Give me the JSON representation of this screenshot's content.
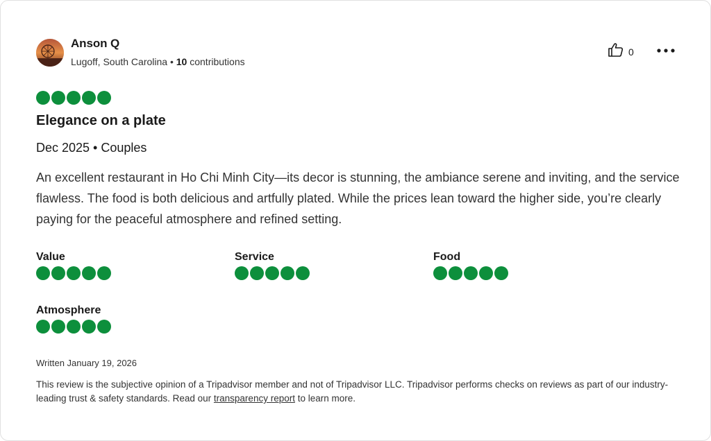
{
  "reviewer": {
    "name": "Anson Q",
    "location": "Lugoff, South Carolina",
    "separator": "•",
    "contributions_count": "10",
    "contributions_label": "contributions"
  },
  "actions": {
    "like_count": "0",
    "like_icon": "thumbs-up-icon",
    "more_icon": "more-horizontal-icon"
  },
  "review": {
    "rating": 5,
    "rating_max": 5,
    "title": "Elegance on a plate",
    "trip_info": "Dec 2025 • Couples",
    "body": "An excellent restaurant in Ho Chi Minh City—its decor is stunning, the ambiance serene and inviting, and the service flawless. The food is both delicious and artfully plated. While the prices lean toward the higher side, you’re clearly paying for the peaceful atmosphere and refined setting."
  },
  "sub_ratings": [
    {
      "label": "Value",
      "rating": 5
    },
    {
      "label": "Service",
      "rating": 5
    },
    {
      "label": "Food",
      "rating": 5
    },
    {
      "label": "Atmosphere",
      "rating": 5
    }
  ],
  "footer": {
    "written": "Written January 19, 2026",
    "disclaimer_before": "This review is the subjective opinion of a Tripadvisor member and not of Tripadvisor LLC. Tripadvisor performs checks on reviews as part of our industry-leading trust & safety standards. Read our ",
    "disclaimer_link": "transparency report",
    "disclaimer_after": " to learn more."
  },
  "colors": {
    "bubble": "#0d8f3c",
    "text": "#1a1a1a"
  }
}
